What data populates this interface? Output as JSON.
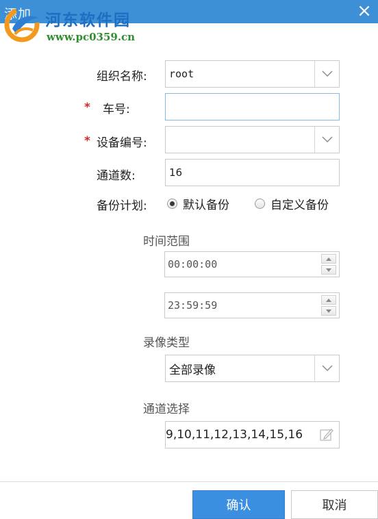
{
  "dialog": {
    "title": "添加",
    "close_glyph": "×",
    "colors": {
      "titlebar": "#3d8fd6",
      "accent": "#3b8fe0",
      "required": "#d12a2a"
    }
  },
  "watermark": {
    "site_name": "河东软件园",
    "url": "www.pc0359.cn"
  },
  "form": {
    "org_name": {
      "label": "组织名称:",
      "value": "root"
    },
    "plate": {
      "required_mark": "*",
      "label": "车号:",
      "value": ""
    },
    "device_no": {
      "required_mark": "*",
      "label": "设备编号:",
      "value": ""
    },
    "channels": {
      "label": "通道数:",
      "value": "16"
    },
    "backup_plan": {
      "label": "备份计划:",
      "options": [
        {
          "label": "默认备份",
          "selected": true
        },
        {
          "label": "自定义备份",
          "selected": false
        }
      ]
    },
    "time_range": {
      "label": "时间范围",
      "start": "00:00:00",
      "end": "23:59:59"
    },
    "record_type": {
      "label": "录像类型",
      "value": "全部录像"
    },
    "channel_select": {
      "label": "通道选择",
      "value": "9,10,11,12,13,14,15,16"
    }
  },
  "buttons": {
    "confirm": "确认",
    "cancel": "取消"
  },
  "icons": {
    "dropdown": "chevron-down-icon",
    "spin_up": "triangle-up-icon",
    "spin_down": "triangle-down-icon",
    "edit": "edit-icon",
    "close": "close-icon"
  }
}
